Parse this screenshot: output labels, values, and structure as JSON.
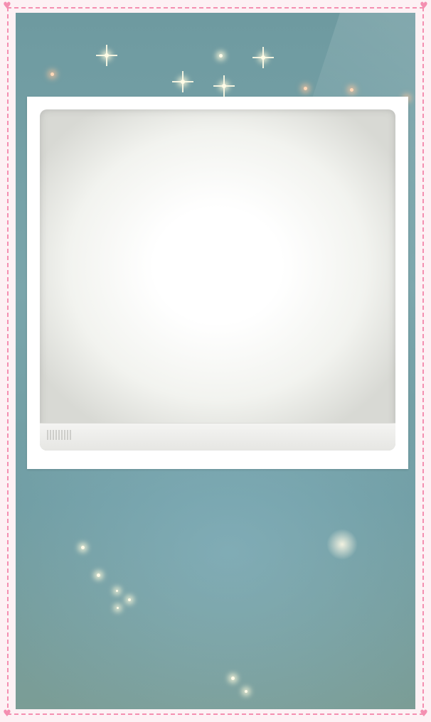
{
  "page": {
    "background_color": "#fdf1f4",
    "border_color": "#f48fb1",
    "scene_color": "#7aa5ab",
    "photo_frame_color": "#ffffff"
  },
  "icons": {
    "corner": "heart-icon",
    "sparkle": "sparkle-icon"
  }
}
